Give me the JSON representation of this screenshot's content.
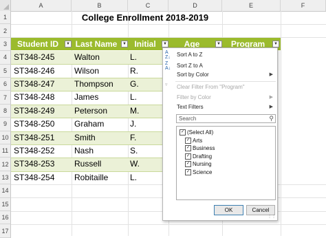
{
  "columns": [
    "A",
    "B",
    "C",
    "D",
    "E",
    "F"
  ],
  "rows": [
    "1",
    "2",
    "3",
    "4",
    "5",
    "6",
    "7",
    "8",
    "9",
    "10",
    "11",
    "12",
    "13",
    "14",
    "15",
    "16",
    "17"
  ],
  "sheet": {
    "title": "College Enrollment 2018-2019",
    "headers": [
      "Student ID",
      "Last Name",
      "Initial",
      "Age",
      "Program"
    ],
    "data": [
      [
        "ST348-245",
        "Walton",
        "L."
      ],
      [
        "ST348-246",
        "Wilson",
        "R."
      ],
      [
        "ST348-247",
        "Thompson",
        "G."
      ],
      [
        "ST348-248",
        "James",
        "L."
      ],
      [
        "ST348-249",
        "Peterson",
        "M."
      ],
      [
        "ST348-250",
        "Graham",
        "J."
      ],
      [
        "ST348-251",
        "Smith",
        "F."
      ],
      [
        "ST348-252",
        "Nash",
        "S."
      ],
      [
        "ST348-253",
        "Russell",
        "W."
      ],
      [
        "ST348-254",
        "Robitaille",
        "L."
      ]
    ]
  },
  "colors": {
    "header_fill": "#9bbb2d",
    "band_fill": "#ebf1d7"
  },
  "filter_menu": {
    "sort_a_z": "Sort A to Z",
    "sort_z_a": "Sort Z to A",
    "sort_by_color": "Sort by Color",
    "clear_filter": "Clear Filter From \"Program\"",
    "filter_by_color": "Filter by Color",
    "text_filters": "Text Filters",
    "search_placeholder": "Search",
    "items": [
      "(Select All)",
      "Arts",
      "Business",
      "Drafting",
      "Nursing",
      "Science"
    ],
    "ok": "OK",
    "cancel": "Cancel"
  }
}
